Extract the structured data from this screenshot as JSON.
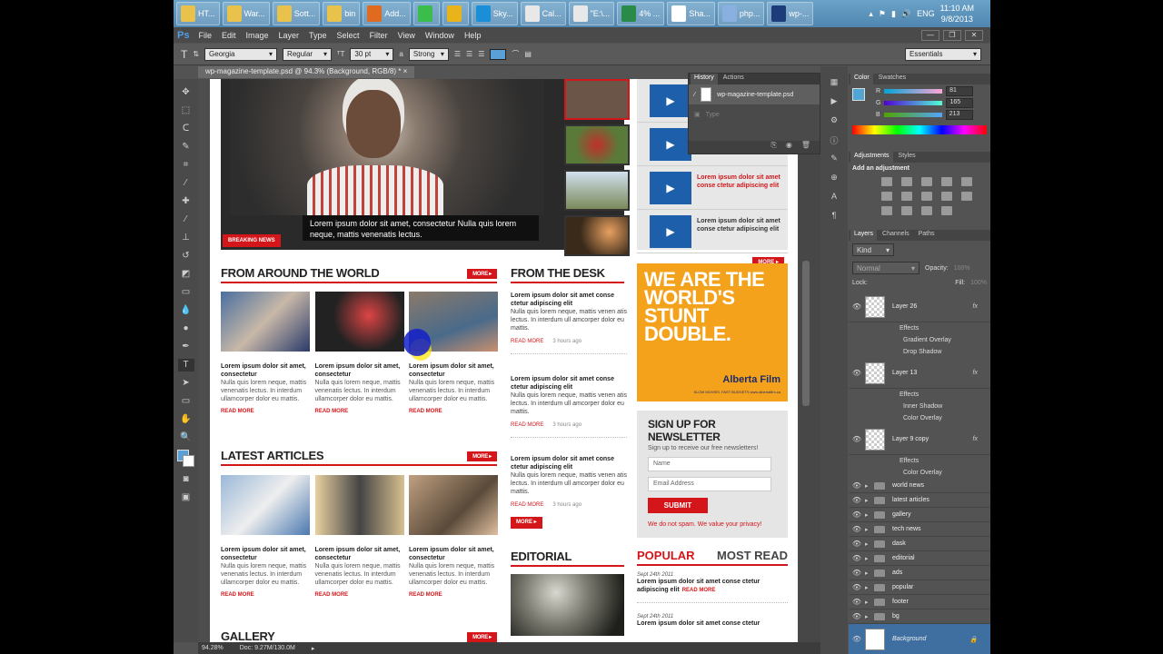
{
  "taskbar": {
    "buttons": [
      "HT...",
      "War...",
      "Sott...",
      "bin",
      "Add...",
      "",
      "",
      "Sky...",
      "Cal...",
      "\"E:\\...",
      "4% ...",
      "Sha...",
      "php...",
      "wp-..."
    ],
    "lang": "ENG",
    "time": "11:10 AM",
    "date": "9/8/2013"
  },
  "menubar": {
    "logo": "Ps",
    "items": [
      "File",
      "Edit",
      "Image",
      "Layer",
      "Type",
      "Select",
      "Filter",
      "View",
      "Window",
      "Help"
    ]
  },
  "options": {
    "font_family": "Georgia",
    "font_style": "Regular",
    "font_size": "30 pt",
    "aa_label": "a",
    "antialias": "Strong",
    "workspace": "Essentials",
    "text_color": "#5aa0d6"
  },
  "document": {
    "tab_title": "wp-magazine-template.psd @ 94.3% (Background, RGB/8) *",
    "zoom": "94.28%",
    "doc_size": "Doc: 9.27M/130.0M"
  },
  "page": {
    "hero_caption": "Lorem ipsum dolor sit amet, consectetur Nulla quis lorem neque, mattis venenatis lectus.",
    "breaking_news": "BREAKING NEWS",
    "video_items": [
      {
        "title": "Lorem ipsum dolor sit amet conse ctetur adipiscing elit",
        "red": true
      },
      {
        "title": "Lorem ipsum dolor sit amet conse ctetur adipiscing elit",
        "red": false
      }
    ],
    "more": "MORE",
    "read_more": "READ MORE",
    "world": {
      "heading": "FROM AROUND THE WORLD",
      "cards": [
        {
          "title": "Lorem ipsum dolor sit amet, consectetur",
          "desc": "Nulla quis lorem neque, mattis venenatis lectus. In interdum ullamcorper dolor eu mattis."
        },
        {
          "title": "Lorem ipsum dolor sit amet, consectetur",
          "desc": "Nulla quis lorem neque, mattis venenatis lectus. In interdum ullamcorper dolor eu mattis."
        },
        {
          "title": "Lorem ipsum dolor sit amet, consectetur",
          "desc": "Nulla quis lorem neque, mattis venenatis lectus. In interdum ullamcorper dolor eu mattis."
        }
      ]
    },
    "latest": {
      "heading": "LATEST ARTICLES",
      "cards": [
        {
          "title": "Lorem ipsum dolor sit amet, consectetur",
          "desc": "Nulla quis lorem neque, mattis venenatis lectus. In interdum ullamcorper dolor eu mattis."
        },
        {
          "title": "Lorem ipsum dolor sit amet, consectetur",
          "desc": "Nulla quis lorem neque, mattis venenatis lectus. In interdum ullamcorper dolor eu mattis."
        },
        {
          "title": "Lorem ipsum dolor sit amet, consectetur",
          "desc": "Nulla quis lorem neque, mattis venenatis lectus. In interdum ullamcorper dolor eu mattis."
        }
      ]
    },
    "gallery_heading": "GALLERY",
    "desk": {
      "heading": "FROM THE DESK",
      "items": [
        {
          "title": "Lorem ipsum dolor sit amet conse ctetur adipiscing elit",
          "desc": "Nulla quis lorem neque, mattis venen atis lectus. In interdum ull amcorper dolor eu mattis.",
          "time": "3 hours ago"
        },
        {
          "title": "Lorem ipsum dolor sit amet conse ctetur adipiscing elit",
          "desc": "Nulla quis lorem neque, mattis venen atis lectus. In interdum ull amcorper dolor eu mattis.",
          "time": "3 hours ago"
        },
        {
          "title": "Lorem ipsum dolor sit amet conse ctetur adipiscing elit",
          "desc": "Nulla quis lorem neque, mattis venen atis lectus. In interdum ull amcorper dolor eu mattis.",
          "time": "3 hours ago"
        }
      ]
    },
    "editorial_heading": "EDITORIAL",
    "ad": {
      "headline": "WE ARE THE WORLD'S STUNT DOUBLE.",
      "brand": "Alberta Film",
      "tagline": "SLOW MOVIES. FAST BUDGETS www.albertafilm.ca"
    },
    "newsletter": {
      "heading": "SIGN UP FOR NEWSLETTER",
      "sub": "Sign up to receive our free newsletters!",
      "name_ph": "Name",
      "email_ph": "Email Address",
      "submit": "SUBMIT",
      "spam": "We do not spam. We value your privacy!"
    },
    "popular": {
      "tab1": "POPULAR",
      "tab2": "MOST READ",
      "items": [
        {
          "date": "Sept 24th 2011",
          "title": "Lorem ipsum dolor sit amet conse ctetur adipiscing elit"
        },
        {
          "date": "Sept 24th 2011",
          "title": "Lorem ipsum dolor sit amet conse ctetur"
        }
      ]
    }
  },
  "history": {
    "tabs": [
      "History",
      "Actions"
    ],
    "snapshot": "wp-magazine-template.psd",
    "step": "Type"
  },
  "color_panel": {
    "tabs": [
      "Color",
      "Swatches"
    ],
    "r": "81",
    "g": "165",
    "b": "213",
    "fg": "#51a5d5"
  },
  "adjustments": {
    "tabs": [
      "Adjustments",
      "Styles"
    ],
    "title": "Add an adjustment"
  },
  "layers": {
    "tabs": [
      "Layers",
      "Channels",
      "Paths"
    ],
    "kind": "Kind",
    "blend": "Normal",
    "opacity_label": "Opacity:",
    "opacity": "100%",
    "lock_label": "Lock:",
    "fill_label": "Fill:",
    "fill": "100%",
    "big": [
      {
        "name": "Layer 26",
        "effects": [
          "Gradient Overlay",
          "Drop Shadow"
        ]
      },
      {
        "name": "Layer 13",
        "effects": [
          "Inner Shadow",
          "Color Overlay"
        ]
      },
      {
        "name": "Layer 9 copy",
        "effects": [
          "Color Overlay"
        ]
      }
    ],
    "effects_label": "Effects",
    "groups": [
      "world news",
      "latest articles",
      "gallery",
      "tech news",
      "dask",
      "editorial",
      "ads",
      "popular",
      "footer",
      "bg"
    ],
    "background": "Background"
  }
}
